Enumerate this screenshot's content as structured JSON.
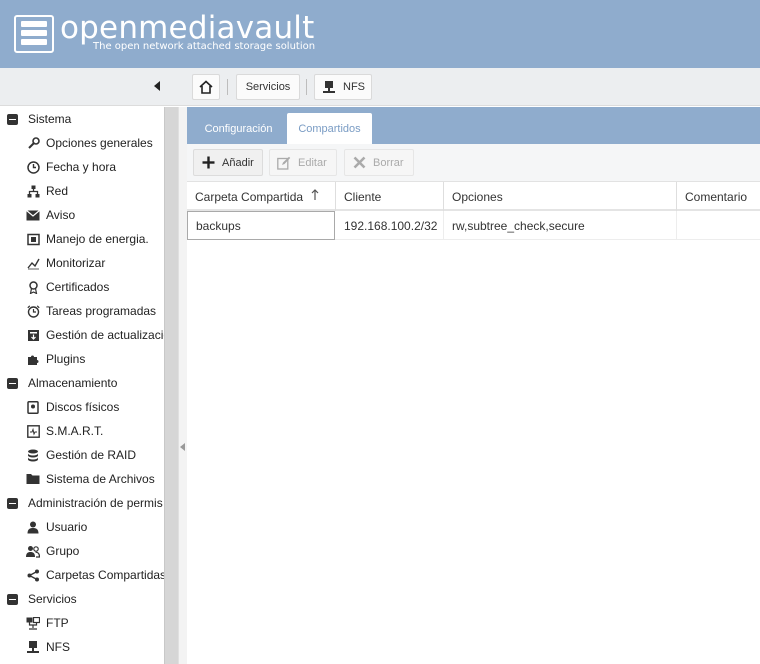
{
  "brand": {
    "name": "openmediavault",
    "tagline": "The open network attached storage solution"
  },
  "breadcrumb": {
    "home_icon": "home-icon",
    "items": [
      "Servicios",
      "NFS"
    ]
  },
  "sidebar": {
    "groups": [
      {
        "label": "Sistema",
        "items": [
          {
            "label": "Opciones generales",
            "icon": "wrench-icon"
          },
          {
            "label": "Fecha y hora",
            "icon": "clock-icon"
          },
          {
            "label": "Red",
            "icon": "network-icon"
          },
          {
            "label": "Aviso",
            "icon": "envelope-icon"
          },
          {
            "label": "Manejo de energia.",
            "icon": "power-icon"
          },
          {
            "label": "Monitorizar",
            "icon": "chart-line-icon"
          },
          {
            "label": "Certificados",
            "icon": "certificate-icon"
          },
          {
            "label": "Tareas programadas",
            "icon": "alarm-clock-icon"
          },
          {
            "label": "Gestión de actualizacic",
            "icon": "update-icon"
          },
          {
            "label": "Plugins",
            "icon": "puzzle-icon"
          }
        ]
      },
      {
        "label": "Almacenamiento",
        "items": [
          {
            "label": "Discos físicos",
            "icon": "disk-icon"
          },
          {
            "label": "S.M.A.R.T.",
            "icon": "smart-icon"
          },
          {
            "label": "Gestión de RAID",
            "icon": "database-icon"
          },
          {
            "label": "Sistema de Archivos",
            "icon": "folder-icon"
          }
        ]
      },
      {
        "label": "Administración de permis",
        "items": [
          {
            "label": "Usuario",
            "icon": "user-icon"
          },
          {
            "label": "Grupo",
            "icon": "group-icon"
          },
          {
            "label": "Carpetas Compartidas",
            "icon": "share-icon"
          }
        ]
      },
      {
        "label": "Servicios",
        "items": [
          {
            "label": "FTP",
            "icon": "ftp-icon"
          },
          {
            "label": "NFS",
            "icon": "nfs-icon"
          }
        ]
      }
    ]
  },
  "tabs": [
    {
      "label": "Configuración",
      "active": false
    },
    {
      "label": "Compartidos",
      "active": true
    }
  ],
  "toolbar": {
    "add_label": "Añadir",
    "edit_label": "Editar",
    "delete_label": "Borrar"
  },
  "grid": {
    "columns": [
      "Carpeta Compartida",
      "Cliente",
      "Opciones",
      "Comentario"
    ],
    "sort_column": "Carpeta Compartida",
    "sort_direction": "ascending",
    "rows": [
      [
        "backups",
        "192.168.100.2/32",
        "rw,subtree_check,secure",
        ""
      ]
    ]
  },
  "colors": {
    "header_bg": "#8faccd",
    "active_tab_text": "#7a9cc4"
  }
}
